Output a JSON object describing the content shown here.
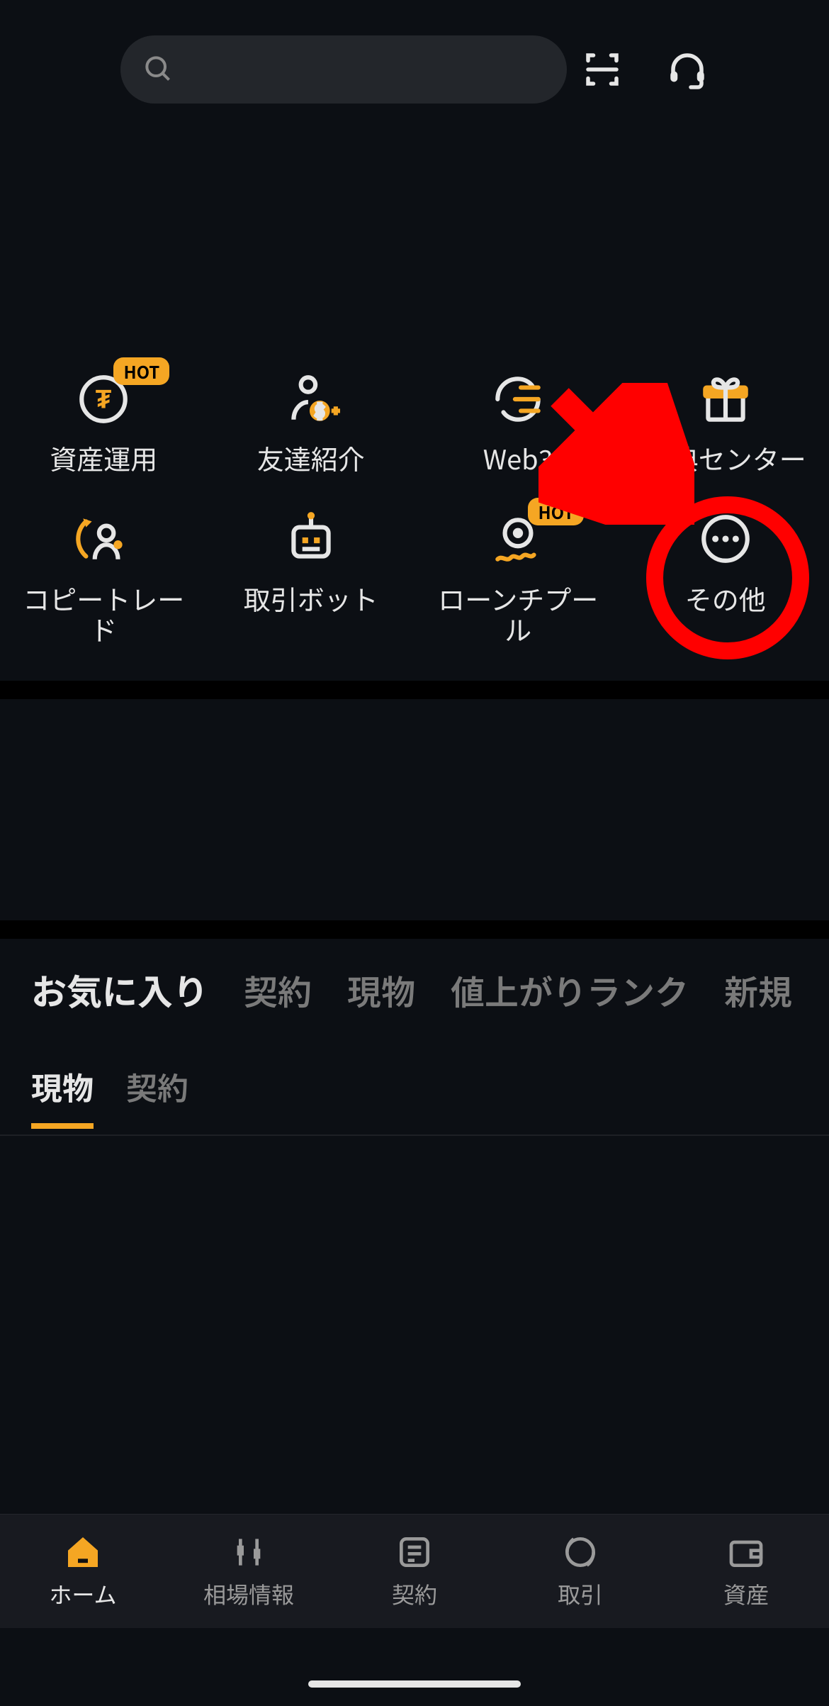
{
  "header": {
    "search_placeholder": "",
    "scan_name": "scan",
    "support_name": "support"
  },
  "shortcuts": [
    {
      "label": "資産運用",
      "badge": "HOT",
      "icon": "earn"
    },
    {
      "label": "友達紹介",
      "badge": null,
      "icon": "referral"
    },
    {
      "label": "Web3",
      "badge": null,
      "icon": "web3"
    },
    {
      "label": "特典センター",
      "badge": null,
      "icon": "rewards"
    },
    {
      "label": "コピートレード",
      "badge": null,
      "icon": "copytrade"
    },
    {
      "label": "取引ボット",
      "badge": null,
      "icon": "bot"
    },
    {
      "label": "ローンチプール",
      "badge": "HOT",
      "icon": "launchpool"
    },
    {
      "label": "その他",
      "badge": null,
      "icon": "more",
      "highlight": true
    }
  ],
  "main_tabs": [
    "お気に入り",
    "契約",
    "現物",
    "値上がりランク",
    "新規"
  ],
  "main_tab_active_index": 0,
  "sub_tabs": [
    "現物",
    "契約"
  ],
  "sub_tab_active_index": 0,
  "tabbar": [
    {
      "label": "ホーム",
      "icon": "home"
    },
    {
      "label": "相場情報",
      "icon": "markets"
    },
    {
      "label": "契約",
      "icon": "futures"
    },
    {
      "label": "取引",
      "icon": "trade"
    },
    {
      "label": "資産",
      "icon": "assets"
    }
  ],
  "tabbar_active_index": 0,
  "accent": "#f5a623"
}
